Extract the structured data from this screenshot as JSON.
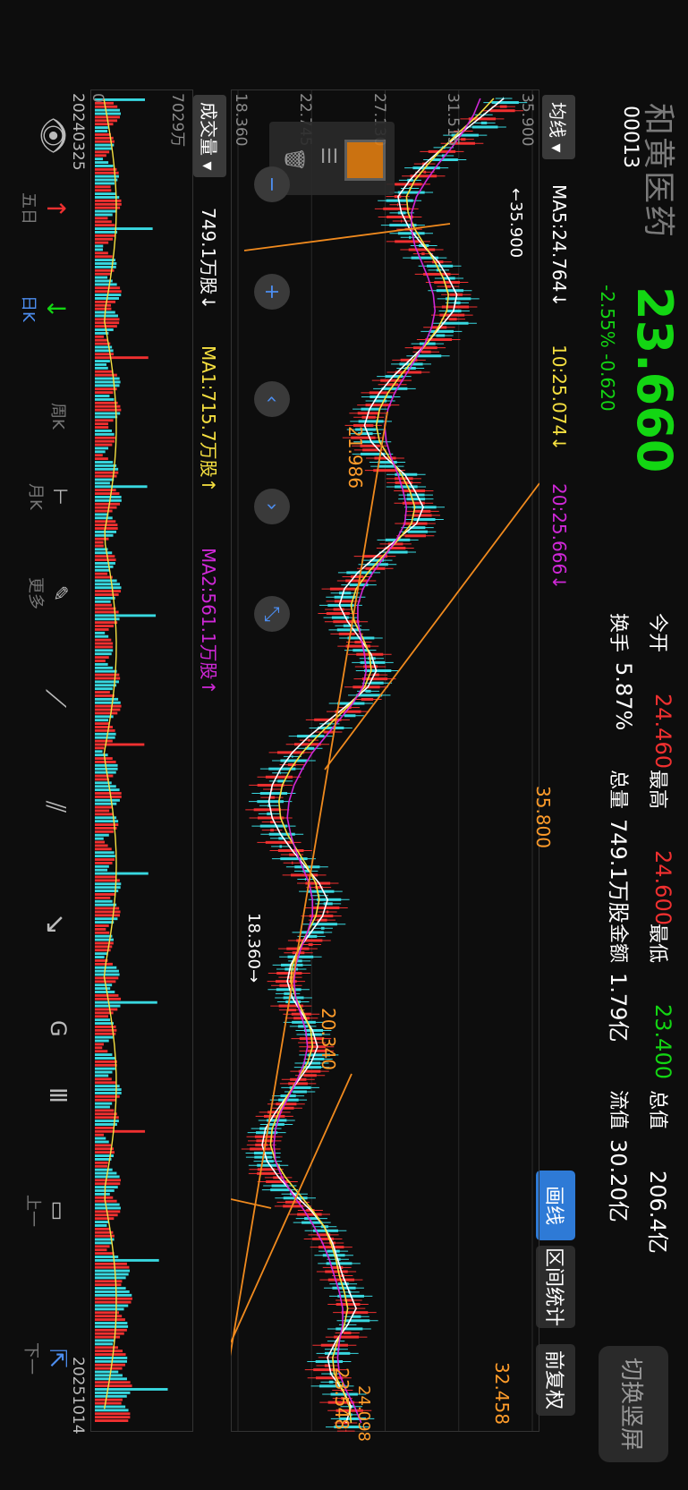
{
  "header": {
    "name": "和黄医药",
    "code": "00013",
    "price": "23.660",
    "change": "-2.55% -0.620",
    "quotes": [
      {
        "label": "今开",
        "value": "24.460",
        "color": "red"
      },
      {
        "label": "最高",
        "value": "24.600",
        "color": "red"
      },
      {
        "label": "最低",
        "value": "23.400",
        "color": "green"
      },
      {
        "label": "总值",
        "value": "206.4亿",
        "color": "white"
      },
      {
        "label": "换手",
        "value": "5.87%",
        "color": "white"
      },
      {
        "label": "总量",
        "value": "749.1万股",
        "color": "white"
      },
      {
        "label": "金额",
        "value": "1.79亿",
        "color": "white"
      },
      {
        "label": "流值",
        "value": "30.20亿",
        "color": "white"
      }
    ],
    "switch_label": "切换竖屏",
    "draw_label": "画线",
    "stat_label": "区间统计",
    "adj_label": "前复权"
  },
  "ma_row": {
    "selector": "均线",
    "ma5": "MA5:24.764↓",
    "ma10": "10:25.074↓",
    "ma20": "20:25.666↓"
  },
  "price_axis": [
    "35.900",
    "31.515",
    "27.130",
    "22.745",
    "18.360"
  ],
  "annotations": {
    "max_label": "←35.900",
    "min_label": "18.360→",
    "line1": "35.800",
    "line2": "21.986",
    "line3": "32.458",
    "line4": "20.340",
    "line5": "23.548",
    "line6": "24.098"
  },
  "volume": {
    "selector": "成交量",
    "value": "749.1万股↓",
    "ma1": "MA1:715.7万股↑",
    "ma2": "MA2:561.1万股↑",
    "axis_top": "7029万",
    "axis_zero": "0",
    "date_start": "20240325",
    "date_end": "20251014"
  },
  "toolbar": [
    "五日",
    "日K",
    "周K",
    "月K",
    "更多",
    "",
    "",
    "",
    "",
    "",
    "上一",
    "下一"
  ],
  "colors": {
    "up": "#f03030",
    "down": "#13d613",
    "ma5": "#ffffff",
    "ma10": "#f6e040",
    "ma20": "#d028d8",
    "accent": "#2e7ad6"
  },
  "chart_data": {
    "type": "line",
    "title": "",
    "series": [
      {
        "name": "MA5",
        "values": [
          34.2,
          33.0,
          31.8,
          30.6,
          29.5,
          28.6,
          27.9,
          28.1,
          28.6,
          29.4,
          30.3,
          30.9,
          31.4,
          31.2,
          30.4,
          29.6,
          28.6,
          27.6,
          26.8,
          26.2,
          25.9,
          26.3,
          27.2,
          28.3,
          28.9,
          29.4,
          29.0,
          27.8,
          26.6,
          25.5,
          24.7,
          24.4,
          24.9,
          25.6,
          26.3,
          26.6,
          26.1,
          25.0,
          23.8,
          22.6,
          21.6,
          20.9,
          20.4,
          20.2,
          20.4,
          20.9,
          21.6,
          22.4,
          23.2,
          23.7,
          23.4,
          22.7,
          22.0,
          21.5,
          21.3,
          21.6,
          22.2,
          22.8,
          23.1,
          22.7,
          22.0,
          21.3,
          20.6,
          20.0,
          19.8,
          20.1,
          20.8,
          21.7,
          22.7,
          23.5,
          24.0,
          24.3,
          24.6,
          25.0,
          25.4,
          24.9,
          24.2,
          23.7,
          23.9,
          24.6,
          25.1,
          24.8
        ]
      },
      {
        "name": "MA10",
        "values": [
          33.6,
          32.7,
          31.6,
          30.6,
          29.7,
          28.9,
          28.4,
          28.5,
          28.9,
          29.5,
          30.1,
          30.6,
          30.9,
          30.8,
          30.3,
          29.6,
          28.8,
          28.0,
          27.3,
          26.8,
          26.6,
          26.8,
          27.4,
          28.1,
          28.6,
          28.9,
          28.7,
          27.9,
          27.0,
          26.1,
          25.4,
          25.1,
          25.3,
          25.8,
          26.2,
          26.3,
          25.9,
          25.1,
          24.1,
          23.1,
          22.2,
          21.5,
          21.0,
          20.8,
          20.9,
          21.3,
          21.9,
          22.5,
          23.0,
          23.2,
          23.0,
          22.5,
          22.0,
          21.6,
          21.5,
          21.8,
          22.3,
          22.7,
          22.8,
          22.5,
          21.9,
          21.3,
          20.8,
          20.4,
          20.3,
          20.6,
          21.2,
          22.0,
          22.8,
          23.5,
          23.9,
          24.2,
          24.4,
          24.7,
          24.9,
          24.7,
          24.3,
          24.0,
          24.1,
          24.6,
          25.0,
          25.1
        ]
      },
      {
        "name": "MA20",
        "values": [
          32.8,
          32.4,
          31.8,
          31.1,
          30.3,
          29.6,
          29.0,
          28.7,
          28.7,
          28.9,
          29.3,
          29.7,
          30.0,
          30.1,
          29.9,
          29.5,
          28.9,
          28.3,
          27.7,
          27.3,
          27.1,
          27.2,
          27.5,
          27.9,
          28.2,
          28.4,
          28.3,
          27.8,
          27.1,
          26.4,
          25.8,
          25.5,
          25.5,
          25.7,
          25.9,
          26.0,
          25.8,
          25.2,
          24.4,
          23.6,
          22.8,
          22.2,
          21.7,
          21.4,
          21.3,
          21.5,
          21.8,
          22.2,
          22.6,
          22.8,
          22.8,
          22.5,
          22.1,
          21.8,
          21.7,
          21.8,
          22.1,
          22.4,
          22.5,
          22.3,
          21.9,
          21.4,
          20.9,
          20.6,
          20.5,
          20.6,
          21.0,
          21.6,
          22.3,
          22.9,
          23.4,
          23.8,
          24.1,
          24.4,
          24.6,
          24.6,
          24.4,
          24.3,
          24.4,
          24.8,
          25.3,
          25.7
        ]
      }
    ],
    "ylim": [
      18.36,
      35.9
    ],
    "xlabel": "",
    "ylabel": "",
    "grid": true
  }
}
